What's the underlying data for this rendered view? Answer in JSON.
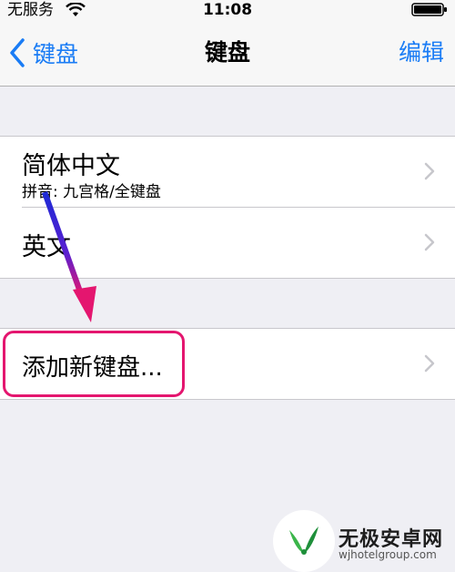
{
  "status_bar": {
    "carrier": "无服务",
    "time": "11:08",
    "wifi_icon": "wifi-icon",
    "battery_icon": "battery-icon"
  },
  "nav": {
    "back_label": "键盘",
    "title": "键盘",
    "edit_label": "编辑"
  },
  "keyboards": [
    {
      "title": "简体中文",
      "subtitle": "拼音: 九宫格/全键盘"
    },
    {
      "title": "英文"
    }
  ],
  "add_keyboard_label": "添加新键盘...",
  "watermark": {
    "name": "无极安卓网",
    "url": "wjhotelgroup.com"
  },
  "colors": {
    "accent": "#1a7cf5",
    "highlight": "#e4166f",
    "background": "#efeff4"
  }
}
